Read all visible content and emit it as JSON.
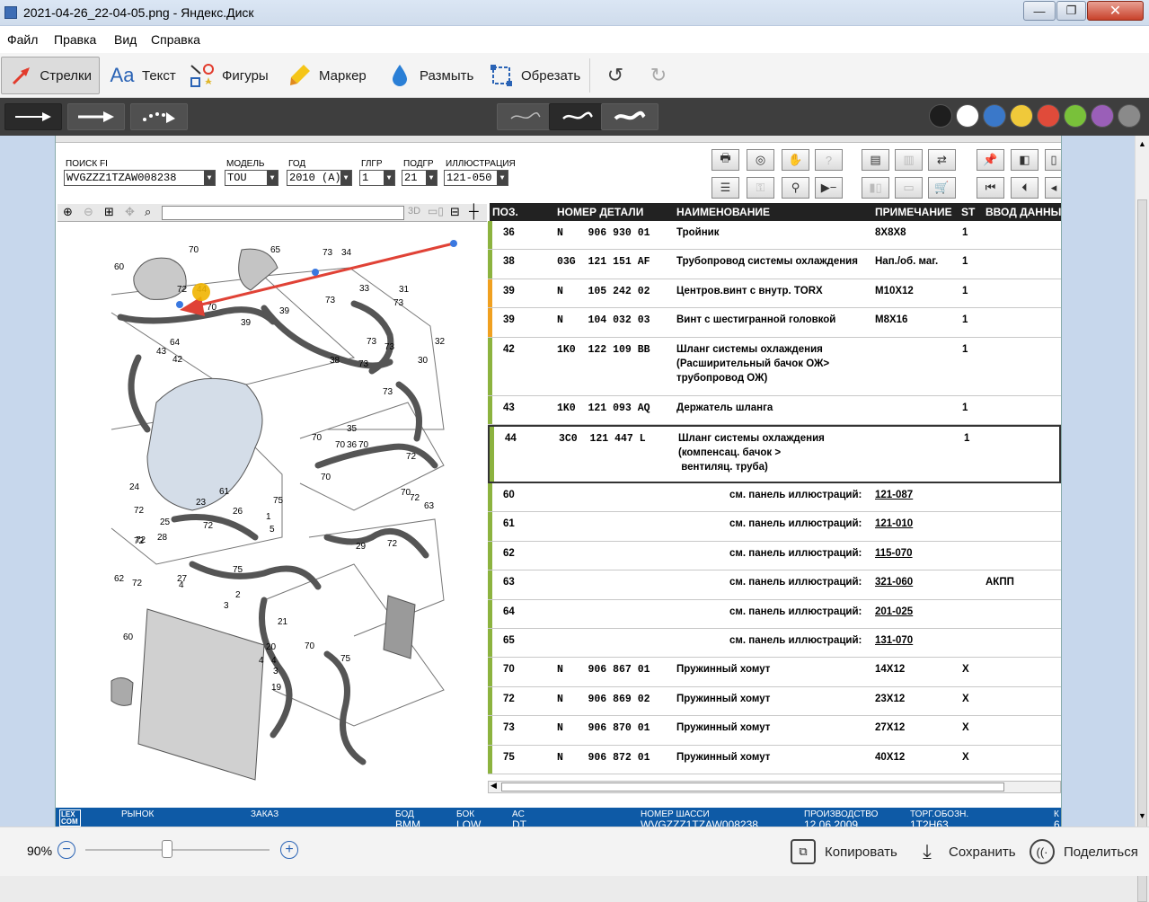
{
  "window": {
    "title": "2021-04-26_22-04-05.png - Яндекс.Диск",
    "min": "—",
    "max": "❐",
    "close": "✕"
  },
  "menu": [
    "Файл",
    "Правка",
    "Вид",
    "Справка"
  ],
  "tools": [
    "Стрелки",
    "Текст",
    "Фигуры",
    "Маркер",
    "Размыть",
    "Обрезать"
  ],
  "palette": [
    "#1e1e1e",
    "#ffffff",
    "#3a78c9",
    "#f0c93a",
    "#e04b3a",
    "#79c13a",
    "#9a5fb8",
    "#8a8a8a"
  ],
  "header": {
    "labels": {
      "vin": "ПОИСК FI",
      "model": "МОДЕЛЬ",
      "year": "ГОД",
      "main_group": "ГЛГР",
      "sub_group": "ПОДГР",
      "illustration": "ИЛЛЮСТРАЦИЯ"
    },
    "values": {
      "vin": "WVGZZZ1TZAW008238",
      "model": "TOU",
      "year": "2010 (A)",
      "main_group": "1",
      "sub_group": "21",
      "illustration": "121-050"
    }
  },
  "table": {
    "columns": [
      "ПОЗ.",
      "НОМЕР ДЕТАЛИ",
      "НАИМЕНОВАНИЕ",
      "ПРИМЕЧАНИЕ",
      "ST",
      "ВВОД ДАННЫ"
    ],
    "rows": [
      {
        "pos": "36",
        "pn": "N    906 930 01",
        "name": [
          "Тройник"
        ],
        "note": "8X8X8",
        "st": "1",
        "extra": ""
      },
      {
        "pos": "38",
        "pn": "03G  121 151 AF",
        "name": [
          "Трубопровод системы охлаждения"
        ],
        "note": "Нап./об. маг.",
        "st": "1",
        "extra": ""
      },
      {
        "pos": "39",
        "pn": "N    105 242 02",
        "name": [
          "Центров.винт с внутр. TORX"
        ],
        "note": "M10X12",
        "st": "1",
        "extra": ""
      },
      {
        "pos": "39",
        "pn": "N    104 032 03",
        "name": [
          "Винт с шестигранной головкой"
        ],
        "note": "M8X16",
        "st": "1",
        "extra": ""
      },
      {
        "pos": "42",
        "pn": "1K0  122 109 BB",
        "name": [
          "Шланг системы охлаждения",
          "(Расширительный бачок ОЖ>",
          "трубопровод ОЖ)"
        ],
        "note": "",
        "st": "1",
        "extra": ""
      },
      {
        "pos": "43",
        "pn": "1K0  121 093 AQ",
        "name": [
          "Держатель шланга"
        ],
        "note": "",
        "st": "1",
        "extra": ""
      },
      {
        "pos": "44",
        "pn": "3C0  121 447 L",
        "name": [
          "Шланг системы охлаждения",
          "(компенсац. бачок >",
          " вентиляц. труба)"
        ],
        "note": "",
        "st": "1",
        "extra": ""
      },
      {
        "pos": "60",
        "ref": "см. панель иллюстраций:",
        "refval": "121-087",
        "extra": ""
      },
      {
        "pos": "61",
        "ref": "см. панель иллюстраций:",
        "refval": "121-010",
        "extra": ""
      },
      {
        "pos": "62",
        "ref": "см. панель иллюстраций:",
        "refval": "115-070",
        "extra": ""
      },
      {
        "pos": "63",
        "ref": "см. панель иллюстраций:",
        "refval": "321-060",
        "extra": "АКПП"
      },
      {
        "pos": "64",
        "ref": "см. панель иллюстраций:",
        "refval": "201-025",
        "extra": ""
      },
      {
        "pos": "65",
        "ref": "см. панель иллюстраций:",
        "refval": "131-070",
        "extra": ""
      },
      {
        "pos": "70",
        "pn": "N    906 867 01",
        "name": [
          "Пружинный хомут"
        ],
        "note": "14X12",
        "st": "X",
        "extra": ""
      },
      {
        "pos": "72",
        "pn": "N    906 869 02",
        "name": [
          "Пружинный хомут"
        ],
        "note": "23X12",
        "st": "X",
        "extra": ""
      },
      {
        "pos": "73",
        "pn": "N    906 870 01",
        "name": [
          "Пружинный хомут"
        ],
        "note": "27X12",
        "st": "X",
        "extra": ""
      },
      {
        "pos": "75",
        "pn": "N    906 872 01",
        "name": [
          "Пружинный хомут"
        ],
        "note": "40X12",
        "st": "X",
        "extra": ""
      }
    ]
  },
  "diagram_labels": [
    "60",
    "70",
    "65",
    "73",
    "34",
    "44",
    "72",
    "70",
    "39",
    "73",
    "33",
    "31",
    "73",
    "39",
    "73",
    "73",
    "32",
    "64",
    "43",
    "42",
    "38",
    "73",
    "30",
    "73",
    "35",
    "70",
    "70",
    "36",
    "70",
    "72",
    "70",
    "70",
    "24",
    "61",
    "23",
    "26",
    "72",
    "25",
    "72",
    "72",
    "75",
    "72",
    "63",
    "28",
    "72",
    "1",
    "5",
    "29",
    "72",
    "62",
    "72",
    "27",
    "75",
    "4",
    "2",
    "3",
    "60",
    "21",
    "20",
    "70",
    "75",
    "4",
    "4",
    "3",
    "19"
  ],
  "status": {
    "logo": "LEX COM",
    "fields": [
      {
        "label": "РЫНОК",
        "value": ""
      },
      {
        "label": "ЗАКАЗ",
        "value": ""
      },
      {
        "label": "БОД",
        "value": "BMM"
      },
      {
        "label": "БОК",
        "value": "LQW"
      },
      {
        "label": "AC",
        "value": "DT"
      },
      {
        "label": "НОМЕР ШАССИ",
        "value": "WVGZZZ1TZAW008238"
      },
      {
        "label": "ПРОИЗВОДСТВО",
        "value": "12.06.2009"
      },
      {
        "label": "ТОРГ.ОБОЗН.",
        "value": "1T2H63"
      },
      {
        "label": "К",
        "value": "6"
      }
    ]
  },
  "zoom": "90%",
  "actions": [
    "Копировать",
    "Сохранить",
    "Поделиться"
  ]
}
